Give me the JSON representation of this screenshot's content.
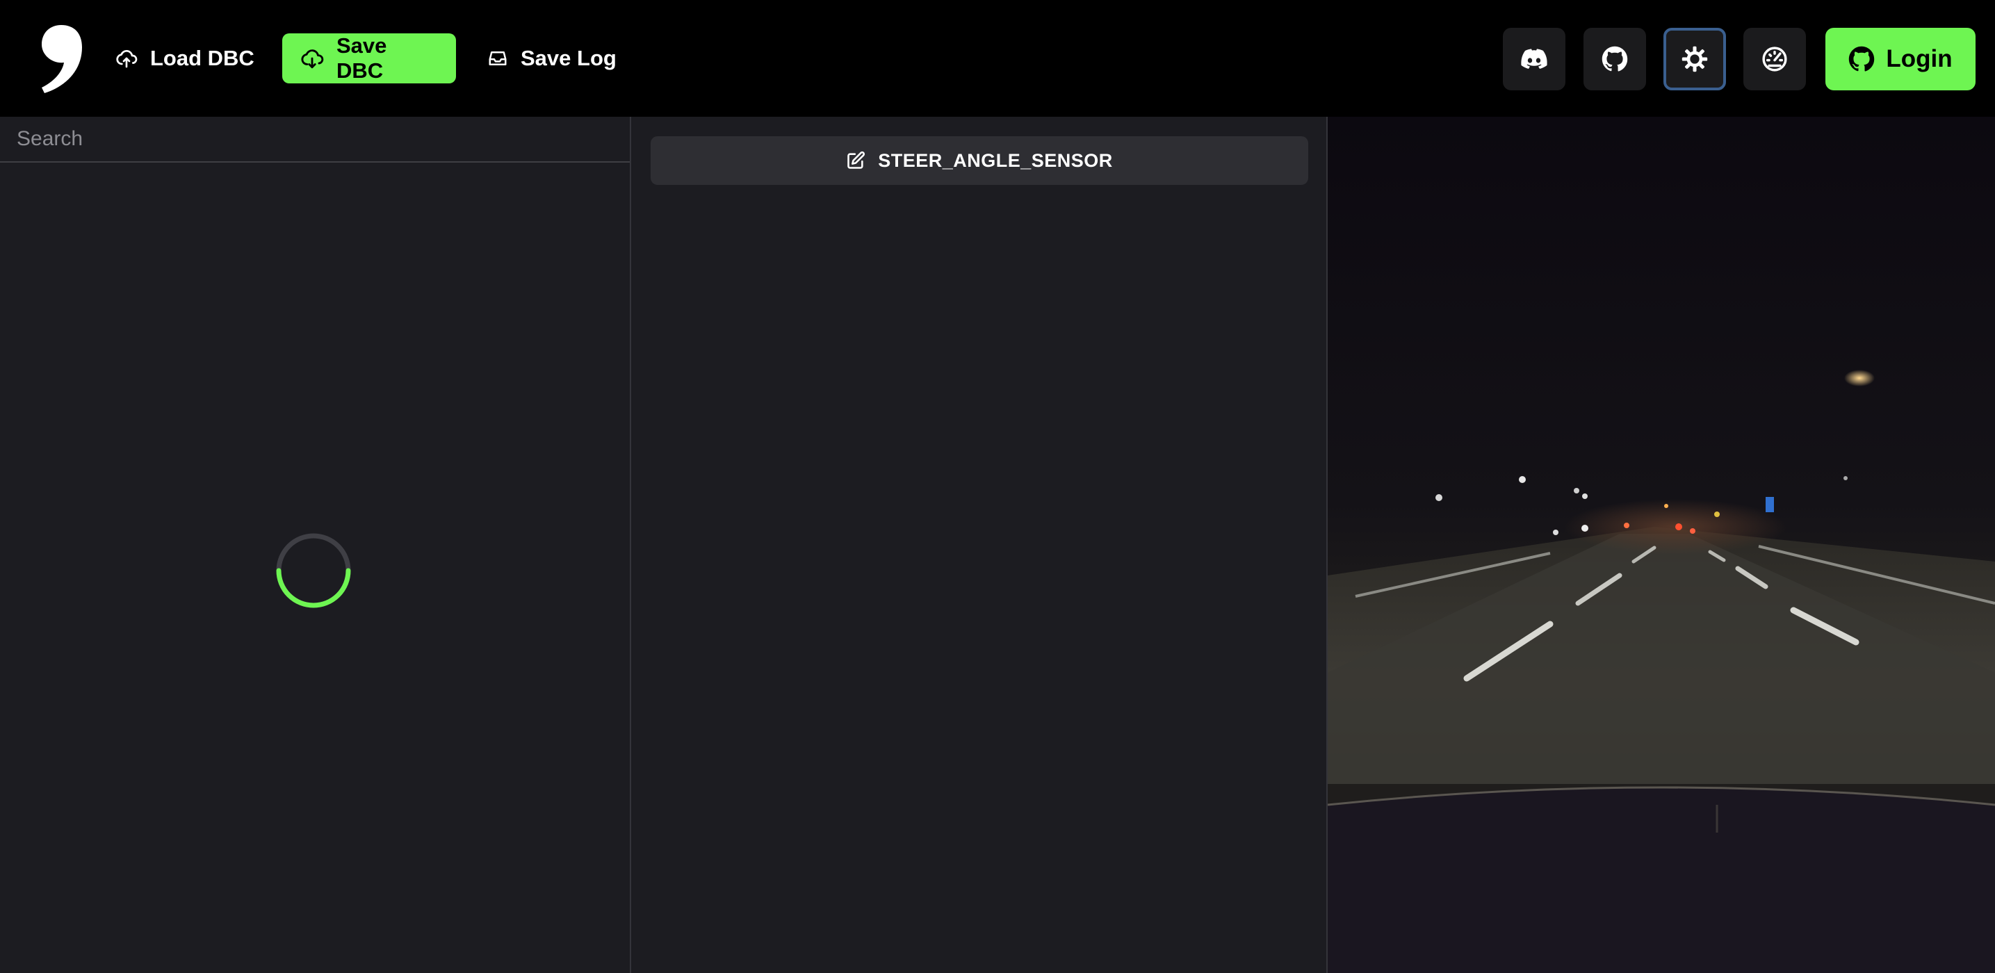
{
  "header": {
    "logo_icon": "comma-logo-icon",
    "load_dbc_label": "Load DBC",
    "save_dbc_label": "Save DBC",
    "save_log_label": "Save Log",
    "login_label": "Login",
    "icons": {
      "load_dbc": "cloud-upload-icon",
      "save_dbc": "cloud-download-icon",
      "save_log": "inbox-icon",
      "discord": "discord-icon",
      "github": "github-icon",
      "theme": "sun-icon",
      "dashboard": "speedometer-icon",
      "login": "github-icon"
    }
  },
  "messages_panel": {
    "search_placeholder": "Search",
    "loading": true
  },
  "detail_panel": {
    "message_name": "STEER_ANGLE_SENSOR",
    "edit_icon": "edit-icon"
  },
  "video": {
    "scene": "night highway dashcam"
  },
  "colors": {
    "accent": "#6ef552",
    "background": "#000000",
    "panel": "#1c1c21",
    "button": "#2e2e33",
    "focus_border": "#3a5f8f"
  }
}
